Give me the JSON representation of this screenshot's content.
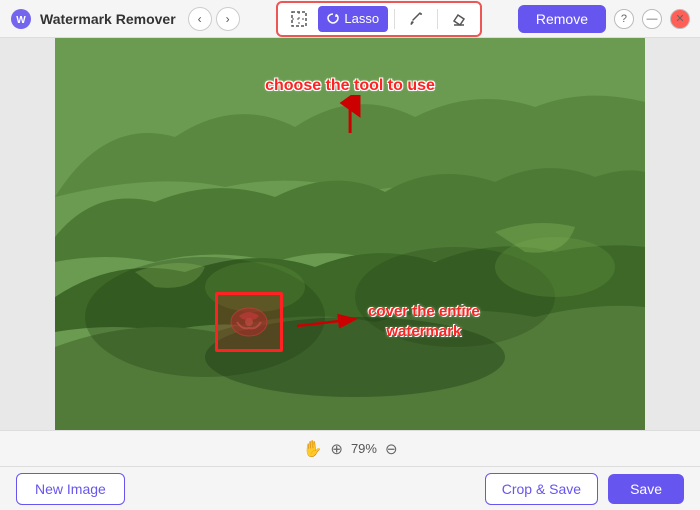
{
  "app": {
    "title": "Watermark Remover",
    "logo_char": "🔵"
  },
  "title_bar": {
    "nav_back_label": "‹",
    "nav_forward_label": "›"
  },
  "toolbar": {
    "tools": [
      {
        "id": "marquee",
        "label": "⊹",
        "active": false
      },
      {
        "id": "lasso",
        "label": "Lasso",
        "active": true
      },
      {
        "id": "brush",
        "label": "✏"
      },
      {
        "id": "erase",
        "label": "◇"
      }
    ],
    "remove_btn": "Remove",
    "help_label": "?",
    "close_label": "✕",
    "minimize_label": "—"
  },
  "canvas": {
    "annotation_top": "choose the tool to use",
    "annotation_bottom_line1": "cover the entire",
    "annotation_bottom_line2": "watermark"
  },
  "bottom_bar": {
    "zoom_level": "79%"
  },
  "footer": {
    "new_image_label": "New Image",
    "crop_save_label": "Crop & Save",
    "save_label": "Save"
  }
}
